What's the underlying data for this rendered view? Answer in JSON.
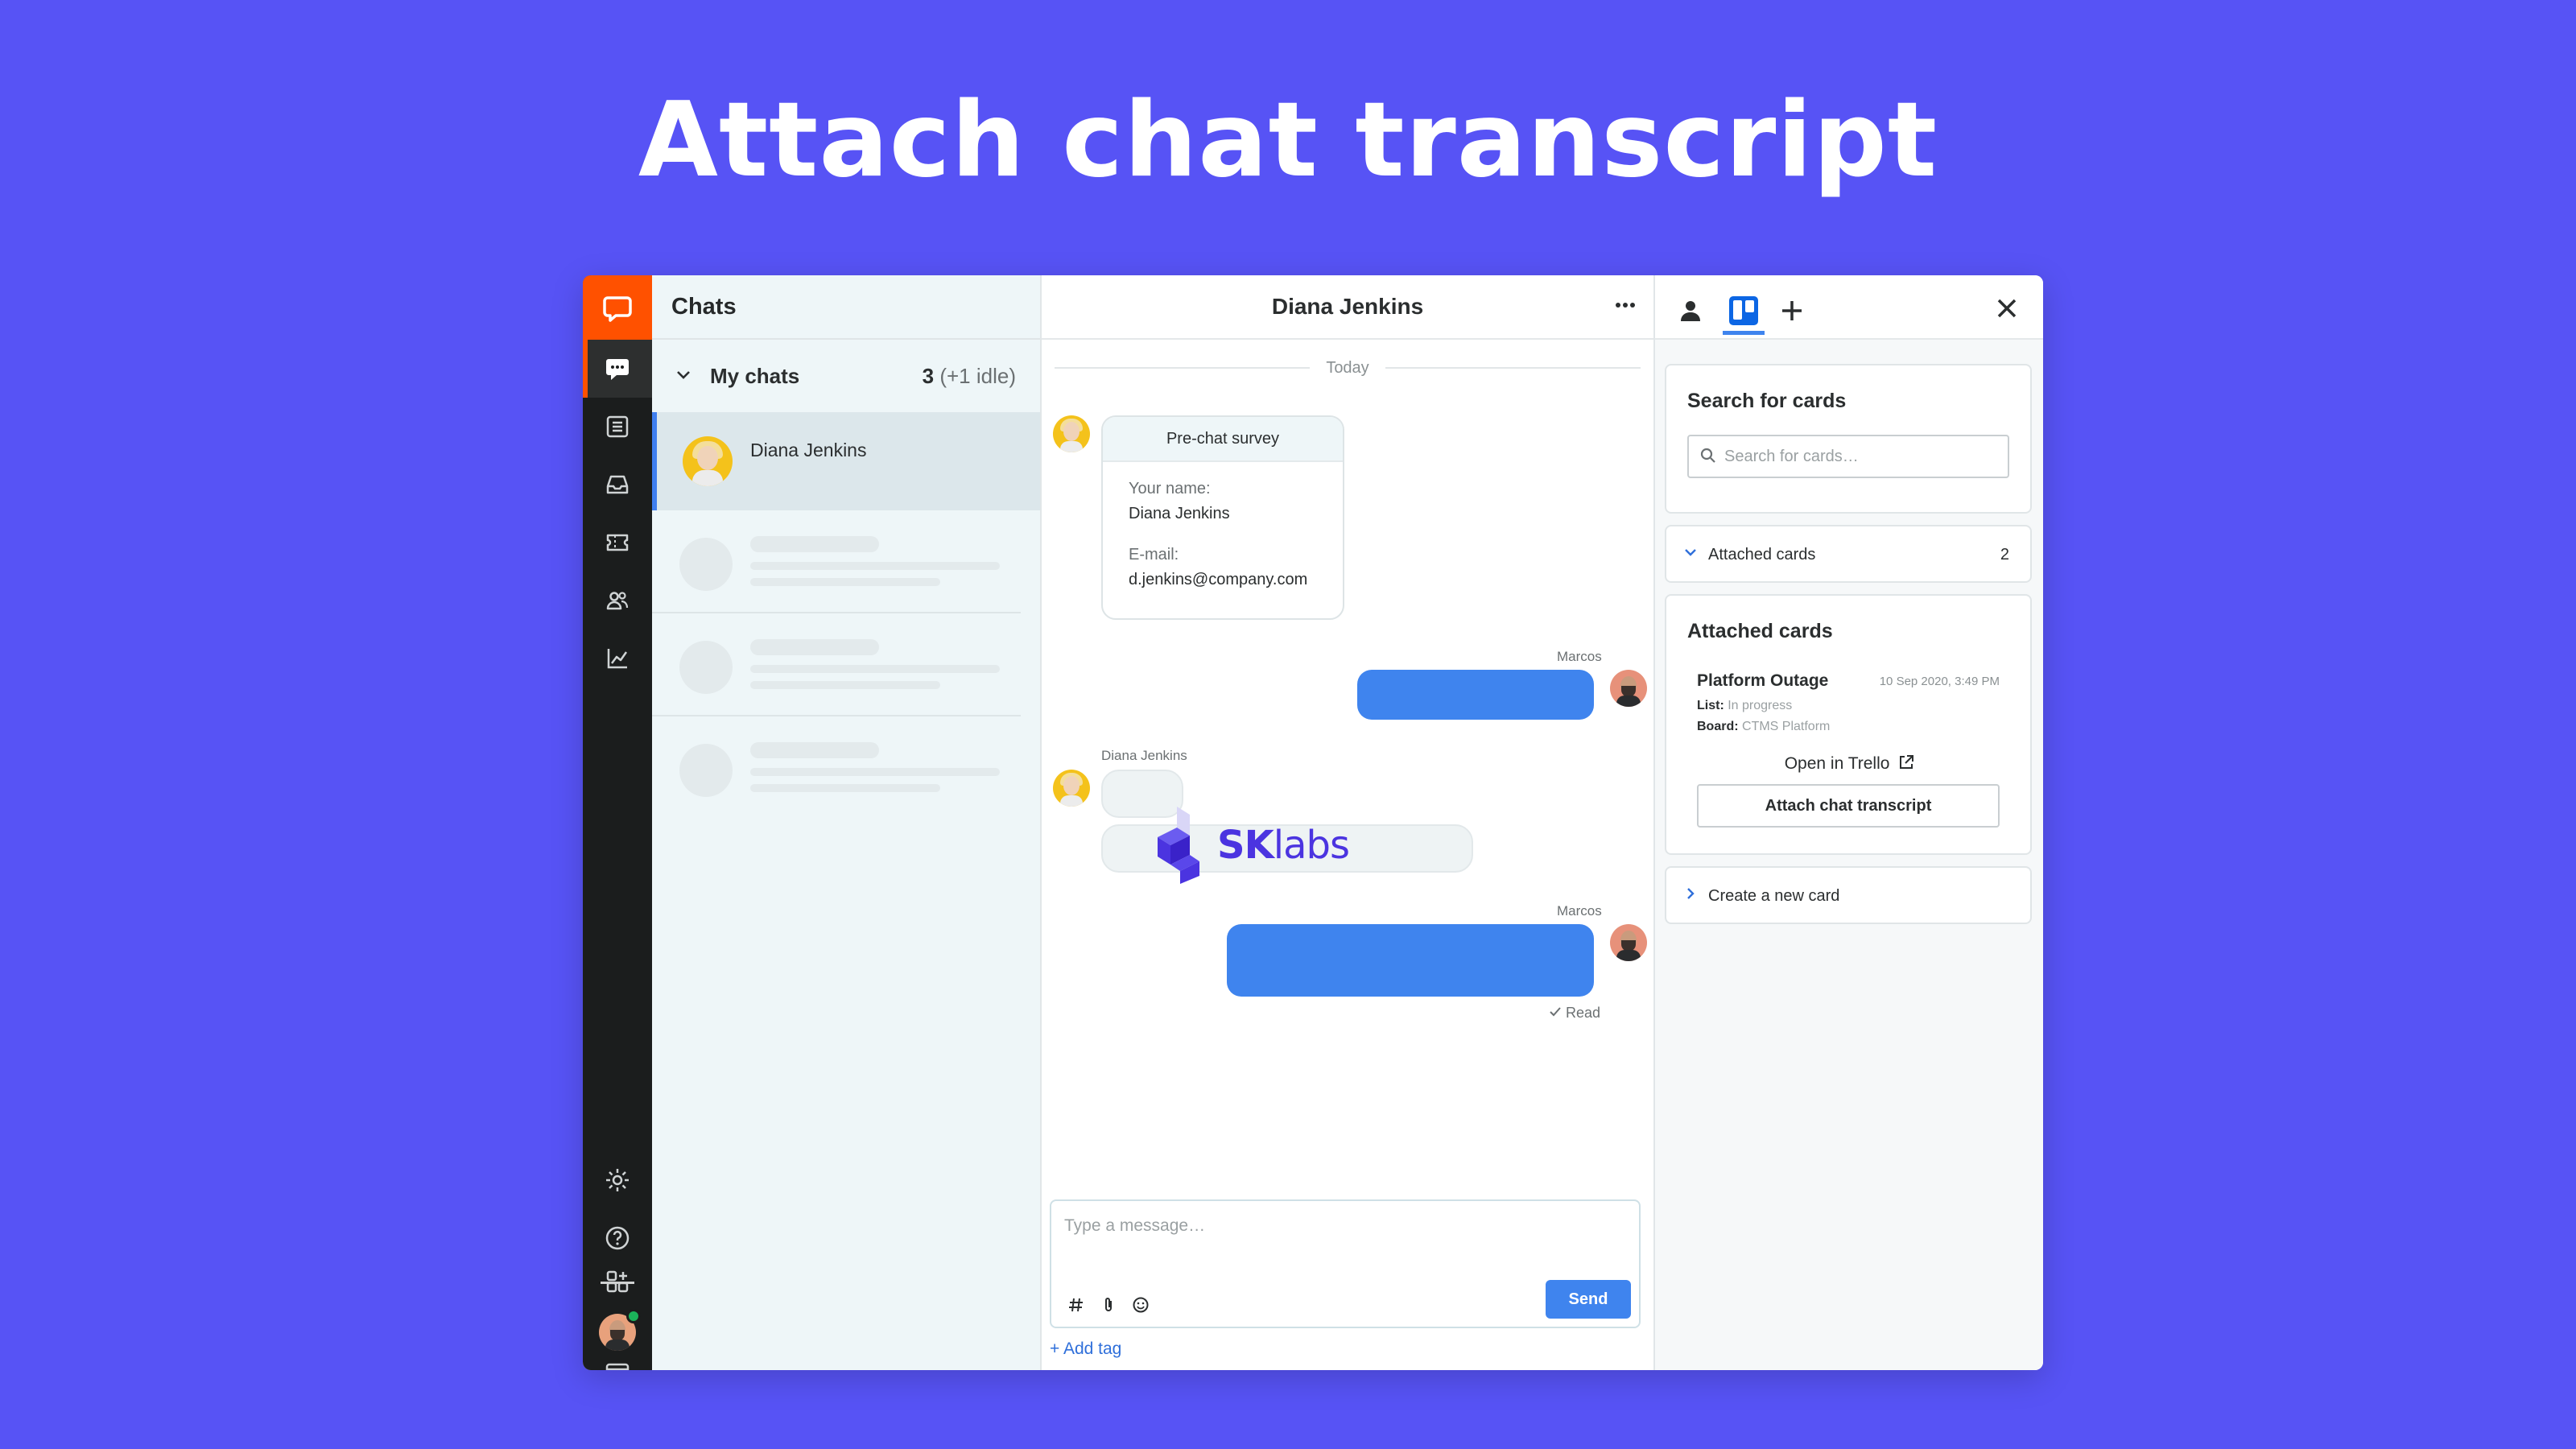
{
  "hero": {
    "title": "Attach chat transcript"
  },
  "chats": {
    "header": "Chats",
    "section_label": "My chats",
    "count": "3",
    "idle": "(+1 idle)",
    "active_chat_name": "Diana Jenkins"
  },
  "chat": {
    "header_name": "Diana Jenkins",
    "date_divider": "Today",
    "survey": {
      "title": "Pre-chat survey",
      "name_label": "Your name:",
      "name_value": "Diana Jenkins",
      "email_label": "E-mail:",
      "email_value": "d.jenkins@company.com"
    },
    "sender_agent": "Marcos",
    "sender_customer": "Diana Jenkins",
    "read_status": "Read",
    "composer_placeholder": "Type a message…",
    "send_label": "Send",
    "add_tag_label": "+ Add tag"
  },
  "panel": {
    "search_title": "Search for cards",
    "search_placeholder": "Search for cards…",
    "attached_accordion_label": "Attached cards",
    "attached_count": "2",
    "attached_title": "Attached cards",
    "card": {
      "name": "Platform Outage",
      "date": "10 Sep 2020, 3:49 PM",
      "list_label": "List:",
      "list_value": "In progress",
      "board_label": "Board:",
      "board_value": "CTMS Platform"
    },
    "open_trello_label": "Open in Trello",
    "attach_button_label": "Attach chat transcript",
    "create_card_label": "Create a new card"
  },
  "brand": {
    "bold": "SK",
    "rest": "labs"
  },
  "colors": {
    "background": "#5753f5",
    "accent_orange": "#ff5100",
    "accent_blue": "#3f84ee",
    "rail": "#1b1d1d",
    "brand": "#4b34e0"
  },
  "icons": {
    "rail": [
      "chat-logo-icon",
      "chats-icon",
      "archives-icon",
      "inbox-icon",
      "tickets-icon",
      "customers-icon",
      "reports-icon",
      "apps-icon",
      "billing-icon",
      "settings-icon",
      "help-icon"
    ],
    "panel_tabs": [
      "customer-icon",
      "trello-icon",
      "add-icon"
    ]
  }
}
